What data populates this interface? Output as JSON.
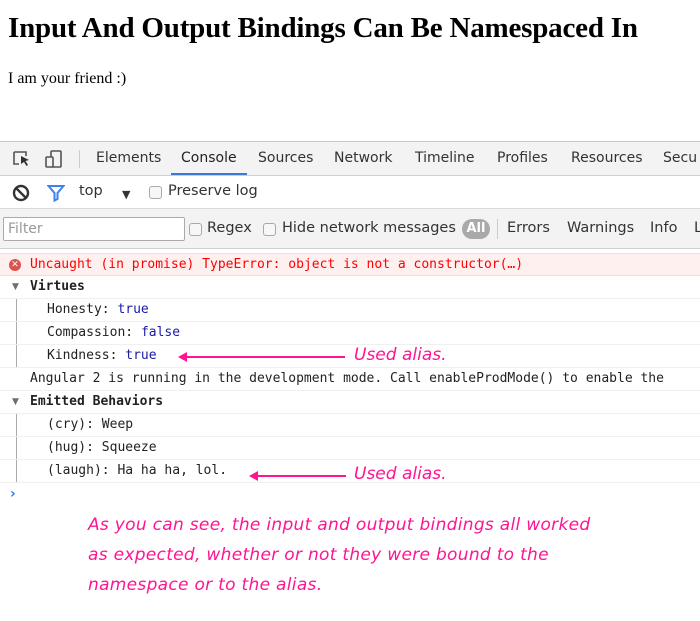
{
  "page": {
    "title": "Input And Output Bindings Can Be Namespaced In",
    "text": "I am your friend :)"
  },
  "devtools": {
    "tabs": [
      {
        "label": "Elements",
        "active": false
      },
      {
        "label": "Console",
        "active": true
      },
      {
        "label": "Sources",
        "active": false
      },
      {
        "label": "Network",
        "active": false
      },
      {
        "label": "Timeline",
        "active": false
      },
      {
        "label": "Profiles",
        "active": false
      },
      {
        "label": "Resources",
        "active": false
      },
      {
        "label": "Secu",
        "active": false
      }
    ],
    "toolbar": {
      "context": "top",
      "preserve_log_label": "Preserve log",
      "preserve_log_checked": false
    },
    "filterbar": {
      "filter_placeholder": "Filter",
      "filter_value": "",
      "regex_label": "Regex",
      "hide_network_label": "Hide network messages",
      "levels": [
        "All",
        "Errors",
        "Warnings",
        "Info",
        "L"
      ],
      "active_level": "All"
    },
    "accent_color": "#3879d9",
    "console": {
      "error": "Uncaught (in promise) TypeError: object is not a constructor(…)",
      "groups": [
        {
          "title": "Virtues",
          "items": [
            {
              "key": "Honesty",
              "value": "true"
            },
            {
              "key": "Compassion",
              "value": "false"
            },
            {
              "key": "Kindness",
              "value": "true"
            }
          ]
        },
        {
          "title": "Emitted Behaviors",
          "items": [
            {
              "key": "(cry)",
              "value": "Weep"
            },
            {
              "key": "(hug)",
              "value": "Squeeze"
            },
            {
              "key": "(laugh)",
              "value": "Ha ha ha, lol."
            }
          ]
        }
      ],
      "log_message": "Angular 2 is running in the development mode. Call enableProdMode() to enable the",
      "prompt": "›"
    }
  },
  "annotations": {
    "alias_label_1": "Used alias.",
    "alias_label_2": "Used alias.",
    "note_line_1": "As you can see, the input and output bindings all worked",
    "note_line_2": "as expected, whether or not they were bound to the",
    "note_line_3": "namespace or to the alias.",
    "color": "#ff1493"
  }
}
